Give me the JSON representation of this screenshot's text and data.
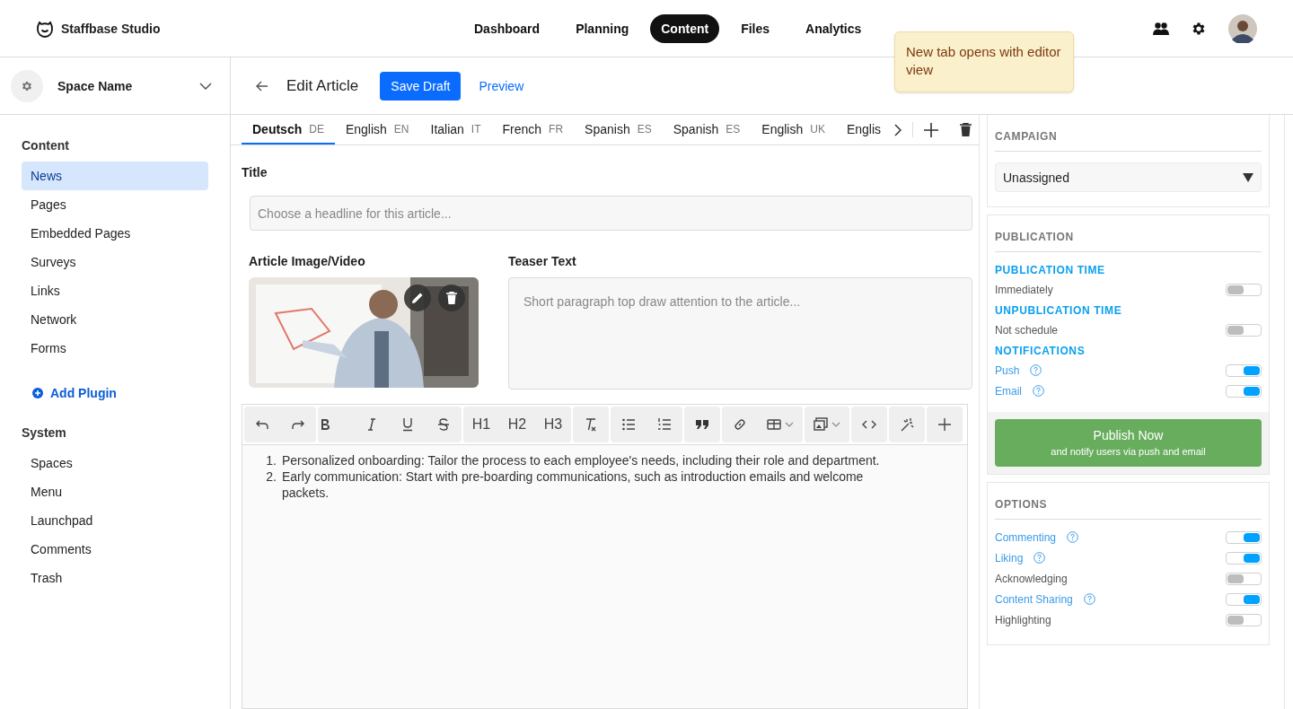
{
  "app": {
    "title": "Staffbase Studio"
  },
  "top_nav": [
    {
      "label": "Dashboard",
      "selected": false
    },
    {
      "label": "Planning",
      "selected": false
    },
    {
      "label": "Content",
      "selected": true
    },
    {
      "label": "Files",
      "selected": false
    },
    {
      "label": "Analytics",
      "selected": false
    }
  ],
  "note": "New tab opens with editor view",
  "space": {
    "name": "Space Name"
  },
  "sidebar": {
    "sections": [
      {
        "title": "Content",
        "items": [
          {
            "label": "News",
            "selected": true
          },
          {
            "label": "Pages",
            "selected": false
          },
          {
            "label": "Embedded Pages",
            "selected": false
          },
          {
            "label": "Surveys",
            "selected": false
          },
          {
            "label": "Links",
            "selected": false
          },
          {
            "label": "Network",
            "selected": false
          },
          {
            "label": "Forms",
            "selected": false
          }
        ],
        "action": "Add Plugin"
      },
      {
        "title": "System",
        "items": [
          {
            "label": "Spaces",
            "selected": false
          },
          {
            "label": "Menu",
            "selected": false
          },
          {
            "label": "Launchpad",
            "selected": false
          },
          {
            "label": "Comments",
            "selected": false
          },
          {
            "label": "Trash",
            "selected": false
          }
        ]
      }
    ]
  },
  "header": {
    "title": "Edit Article",
    "save_button": "Save Draft",
    "preview_link": "Preview"
  },
  "language_tabs": [
    {
      "name": "Deutsch",
      "code": "DE",
      "selected": true
    },
    {
      "name": "English",
      "code": "EN",
      "selected": false
    },
    {
      "name": "Italian",
      "code": "IT",
      "selected": false
    },
    {
      "name": "French",
      "code": "FR",
      "selected": false
    },
    {
      "name": "Spanish",
      "code": "ES",
      "selected": false
    },
    {
      "name": "Spanish",
      "code": "ES",
      "selected": false
    },
    {
      "name": "English",
      "code": "UK",
      "selected": false
    },
    {
      "name": "Englis",
      "selected": false
    }
  ],
  "title_field": {
    "label": "Title",
    "placeholder": "Choose a headline for this article..."
  },
  "media": {
    "label": "Article Image/Video",
    "kind": "picture"
  },
  "teaser": {
    "label": "Teaser Text",
    "placeholder": "Short paragraph top draw attention to the article..."
  },
  "toolbar": {
    "headings": [
      "H1",
      "H2",
      "H3"
    ]
  },
  "body": [
    {
      "marker": "1.",
      "text": "Personalized onboarding: Tailor the process to each employee's needs, including their role and department."
    },
    {
      "marker": "2.",
      "text": "Early communication: Start with pre-boarding communications, such as introduction emails and welcome packets."
    }
  ],
  "campaign": {
    "title": "CAMPAIGN",
    "value": "Unassigned"
  },
  "publication": {
    "title": "PUBLICATION",
    "groups": [
      {
        "heading": "PUBLICATION TIME",
        "rows": [
          {
            "label": "Immediately",
            "on": false,
            "help": false
          }
        ]
      },
      {
        "heading": "UNPUBLICATION TIME",
        "rows": [
          {
            "label": "Not schedule",
            "on": false,
            "help": false
          }
        ]
      },
      {
        "heading": "NOTIFICATIONS",
        "rows": [
          {
            "label": "Push",
            "on": true,
            "help": true
          },
          {
            "label": "Email",
            "on": true,
            "help": true
          }
        ]
      }
    ],
    "publish_button": {
      "label": "Publish Now",
      "sub": "and notify users via push and email"
    }
  },
  "options": {
    "title": "OPTIONS",
    "rows": [
      {
        "label": "Commenting",
        "on": true,
        "help": true
      },
      {
        "label": "Liking",
        "on": true,
        "help": true
      },
      {
        "label": "Acknowledging",
        "on": false,
        "help": false
      },
      {
        "label": "Content Sharing",
        "on": true,
        "help": true
      },
      {
        "label": "Highlighting",
        "on": false,
        "help": false
      }
    ]
  }
}
